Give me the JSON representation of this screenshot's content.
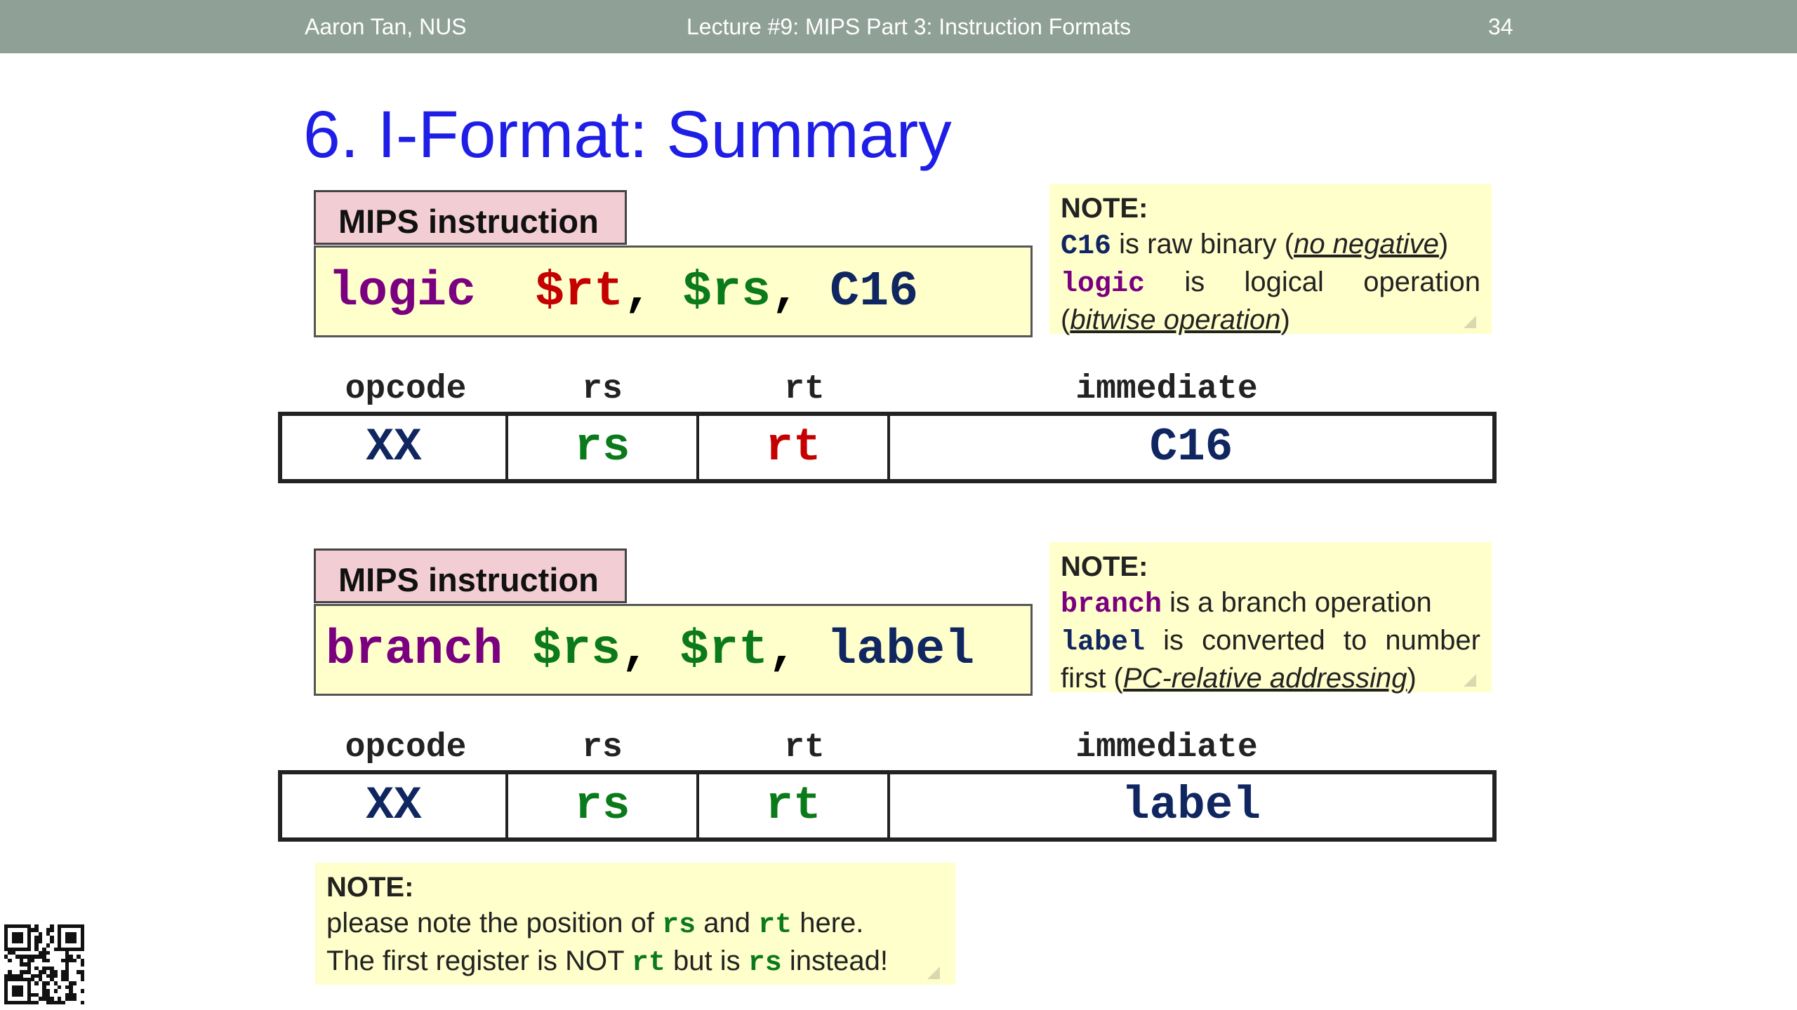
{
  "header": {
    "author": "Aaron Tan, NUS",
    "lecture": "Lecture #9: MIPS Part 3: Instruction Formats",
    "page_number": "34"
  },
  "title": "6. I-Format: Summary",
  "logic_block": {
    "tab_label": "MIPS instruction",
    "instruction": {
      "op": "logic",
      "arg1": "$rt",
      "sep1": ", ",
      "arg2": "$rs",
      "sep2": ", ",
      "arg3": "C16"
    },
    "field_labels": [
      "opcode",
      "rs",
      "rt",
      "immediate"
    ],
    "fields": [
      "XX",
      "rs",
      "rt",
      "C16"
    ],
    "note": {
      "heading": "NOTE:",
      "line1_code": "C16",
      "line1_text": " is raw binary (",
      "line1_em": "no negative",
      "line1_end": ")",
      "line2_code": "logic",
      "line2_text": " is logical operation",
      "line3_open": "(",
      "line3_em": "bitwise operation",
      "line3_close": ")"
    }
  },
  "branch_block": {
    "tab_label": "MIPS instruction",
    "instruction": {
      "op": "branch",
      "arg1": "$rs",
      "sep1": ", ",
      "arg2": "$rt",
      "sep2": ", ",
      "arg3": "label"
    },
    "field_labels": [
      "opcode",
      "rs",
      "rt",
      "immediate"
    ],
    "fields": [
      "XX",
      "rs",
      "rt",
      "label"
    ],
    "note": {
      "heading": "NOTE:",
      "line1_code": "branch",
      "line1_text": " is a branch operation",
      "line2_code": "label",
      "line2_text": " is converted to number",
      "line3_text": "first (",
      "line3_em": "PC-relative addressing",
      "line3_close": ")"
    }
  },
  "bottom_note": {
    "heading": "NOTE:",
    "l1_a": "please note the position of ",
    "l1_code1": "rs",
    "l1_b": " and ",
    "l1_code2": "rt",
    "l1_c": " here.",
    "l2_a": "The first register is NOT ",
    "l2_code1": "rt",
    "l2_b": " but is ",
    "l2_code2": "rs",
    "l2_c": " instead!"
  },
  "colors": {
    "header_bg": "#8fa097",
    "title": "#1e1ee6",
    "note_bg": "#ffffcc",
    "tab_bg": "#f2cdd3",
    "opcode_purple": "#7a0080",
    "rt_red": "#c40000",
    "rs_green": "#0a7a1a",
    "imm_navy": "#102660"
  },
  "icons": {
    "qr": "qr-code-icon"
  }
}
